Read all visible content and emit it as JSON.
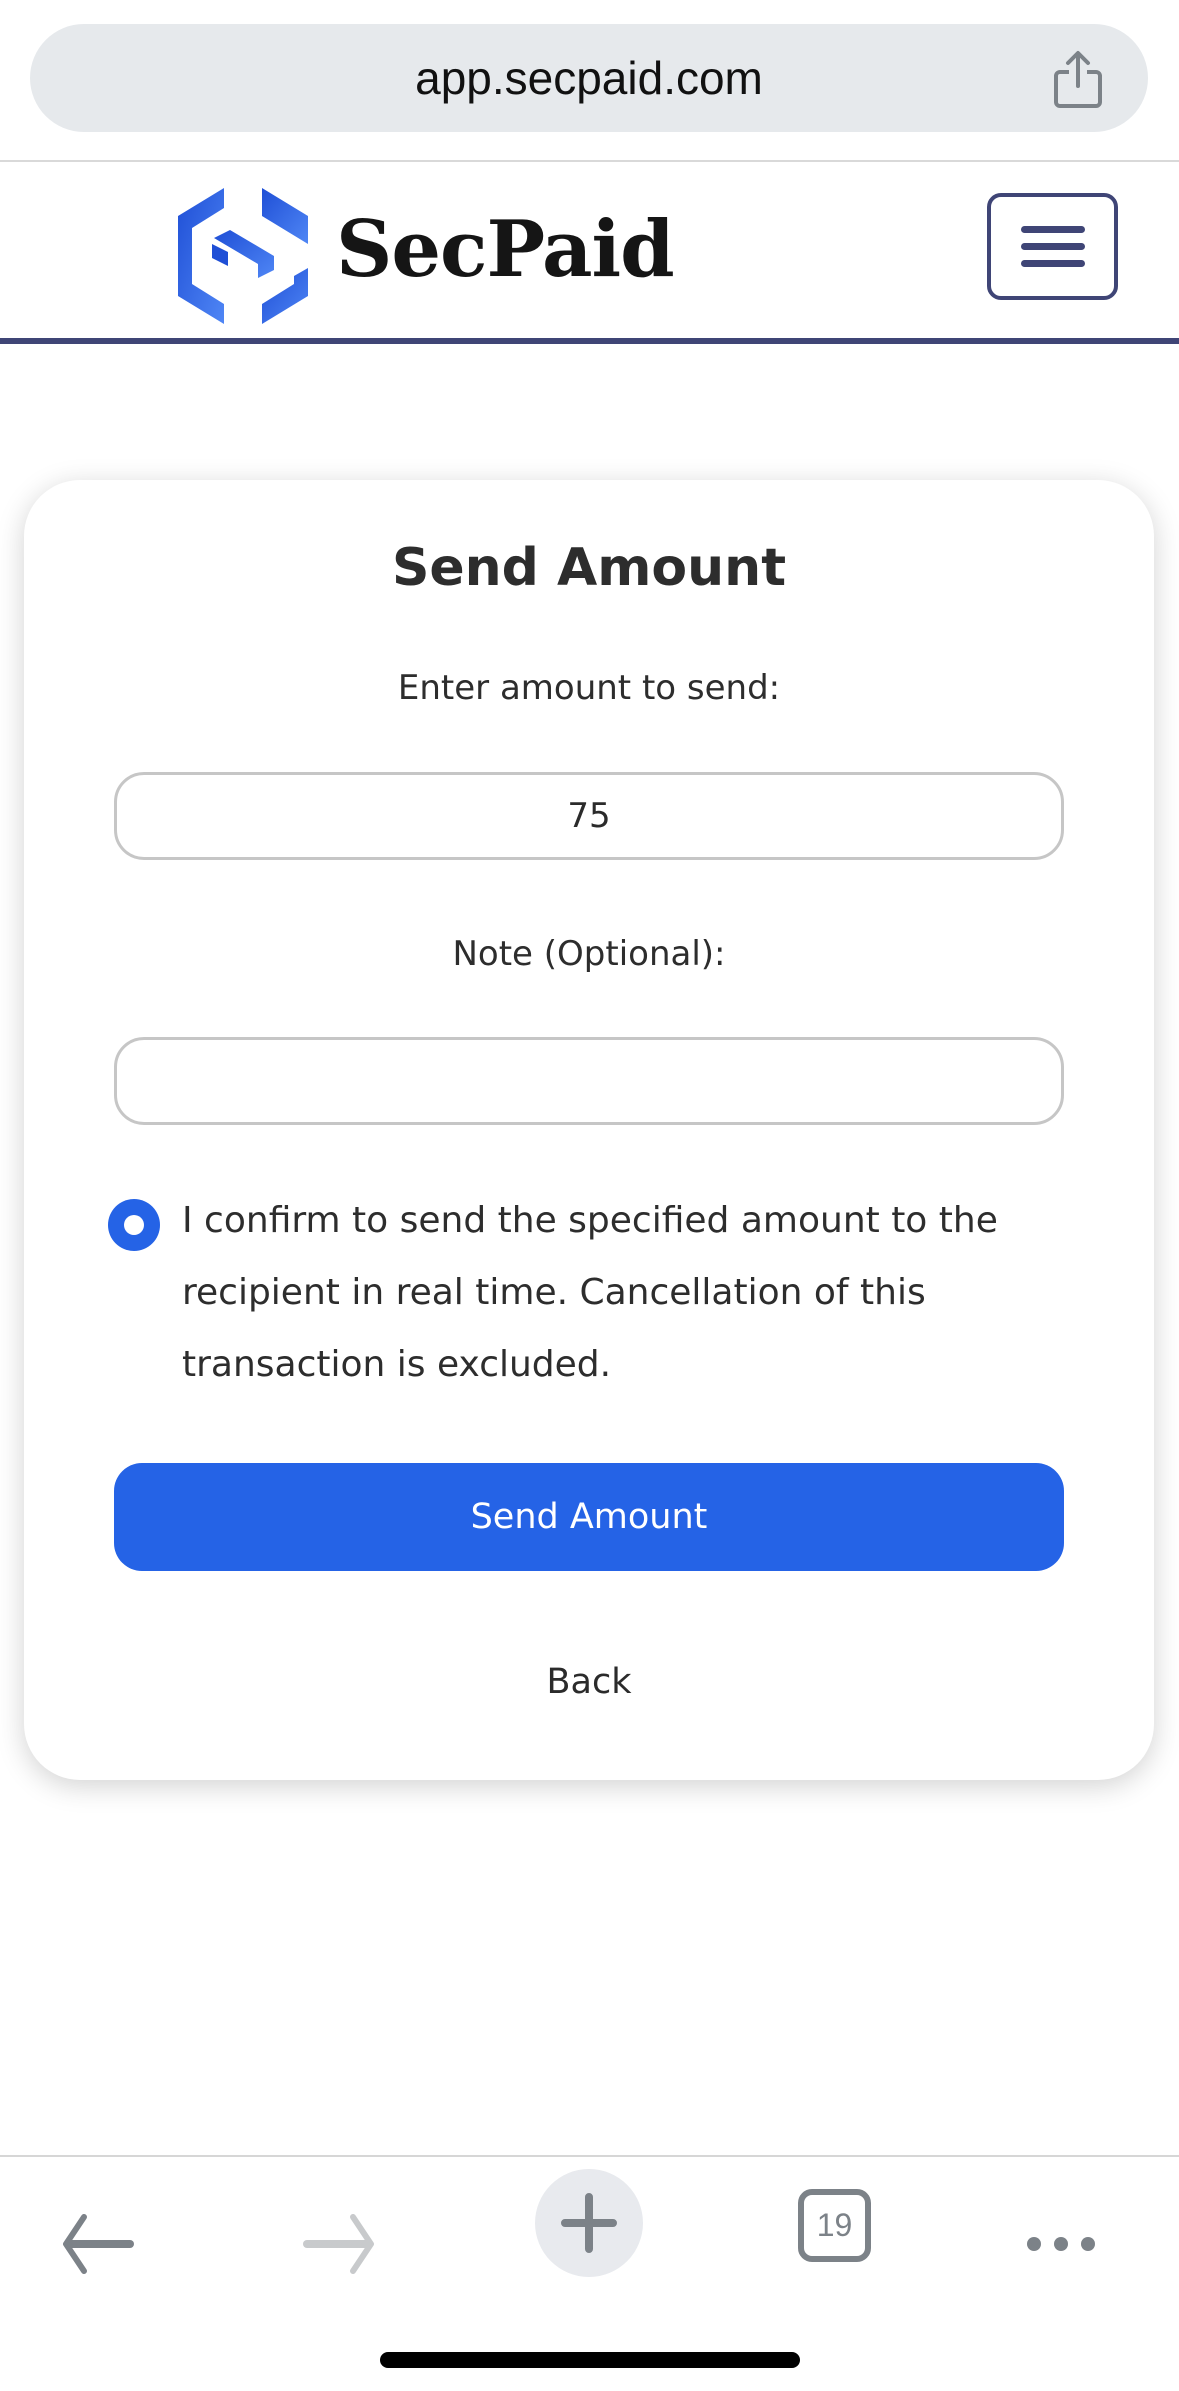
{
  "browser": {
    "url": "app.secpaid.com",
    "share_icon": "share-icon",
    "toolbar": {
      "back_icon": "arrow-left-icon",
      "forward_icon": "arrow-right-icon",
      "new_tab_icon": "plus-icon",
      "tab_count": "19",
      "more_icon": "ellipsis-icon"
    }
  },
  "header": {
    "brand": "SecPaid",
    "logo_icon": "secpaid-logo-icon",
    "menu_icon": "hamburger-menu-icon"
  },
  "form": {
    "title": "Send Amount",
    "amount_label": "Enter amount to send:",
    "amount_value": "75",
    "note_label": "Note (Optional):",
    "note_value": "",
    "confirm_text": "I confirm to send the specified amount to the recipient in real time. Cancellation of this transaction is excluded.",
    "confirm_checked": true,
    "submit_label": "Send Amount",
    "back_label": "Back"
  },
  "colors": {
    "accent": "#2563e6",
    "header_border": "#3f4576",
    "url_bar_bg": "#e6e9ec"
  }
}
